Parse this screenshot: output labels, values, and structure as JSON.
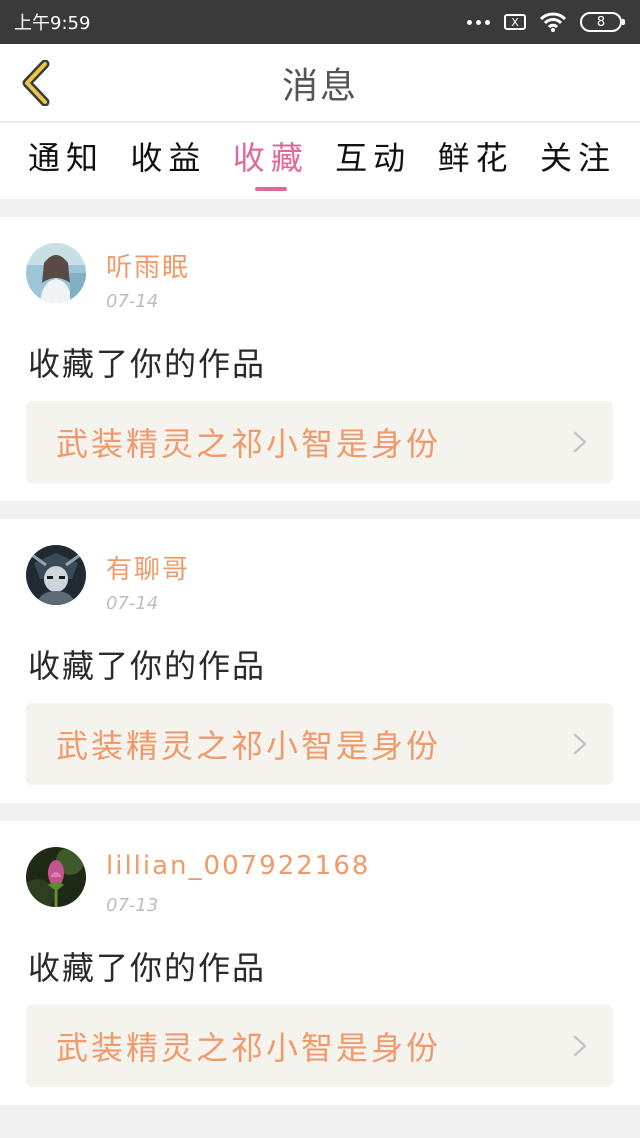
{
  "status_bar": {
    "time": "上午9:59",
    "sim_icon": "sim-card-icon",
    "sim_label": "X",
    "wifi_icon": "wifi-icon",
    "battery_level": "8"
  },
  "header": {
    "title": "消息",
    "back_icon": "chevron-left-icon",
    "accent_color": "#e8c84a"
  },
  "tabs": [
    {
      "label": "通知",
      "active": false
    },
    {
      "label": "收益",
      "active": false
    },
    {
      "label": "收藏",
      "active": true
    },
    {
      "label": "互动",
      "active": false
    },
    {
      "label": "鲜花",
      "active": false
    },
    {
      "label": "关注",
      "active": false
    }
  ],
  "colors": {
    "active_tab": "#e2689b",
    "username": "#f09a6a",
    "work_title": "#f09a6a",
    "link_bg": "#f4f3ed"
  },
  "messages": [
    {
      "username": "听雨眠",
      "date": "07-14",
      "action": "收藏了你的作品",
      "work_title": "武装精灵之祁小智是身份",
      "avatar_style": "light-blue-portrait"
    },
    {
      "username": "有聊哥",
      "date": "07-14",
      "action": "收藏了你的作品",
      "work_title": "武装精灵之祁小智是身份",
      "avatar_style": "dark-anime-portrait"
    },
    {
      "username": "lillian_007922168",
      "date": "07-13",
      "action": "收藏了你的作品",
      "work_title": "武装精灵之祁小智是身份",
      "avatar_style": "flower-bud"
    }
  ]
}
